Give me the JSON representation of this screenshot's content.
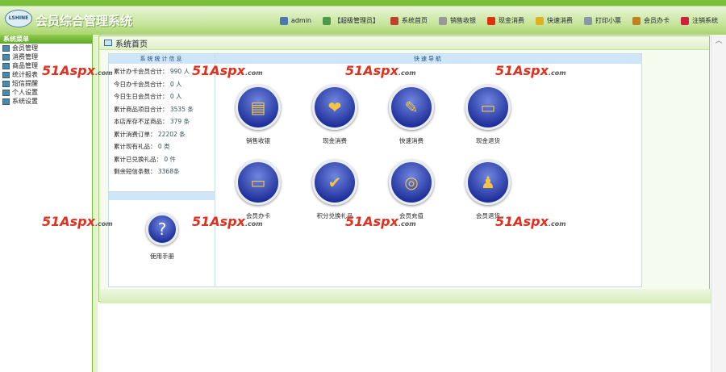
{
  "header": {
    "logo_text": "LSHINE",
    "title": "会员综合管理系统",
    "nav": [
      {
        "label": "admin",
        "icon": "user-icon",
        "color": "#4a7ab0"
      },
      {
        "label": "【超级管理员】",
        "icon": "users-icon",
        "color": "#4a9a4a"
      },
      {
        "label": "系统首页",
        "icon": "home-icon",
        "color": "#c04030"
      },
      {
        "label": "销售收银",
        "icon": "cashier-icon",
        "color": "#999999"
      },
      {
        "label": "现金消费",
        "icon": "cash-icon",
        "color": "#e03010"
      },
      {
        "label": "快速消费",
        "icon": "fast-pay-icon",
        "color": "#e0b020"
      },
      {
        "label": "打印小票",
        "icon": "print-icon",
        "color": "#8899aa"
      },
      {
        "label": "会员办卡",
        "icon": "card-icon",
        "color": "#c08020"
      },
      {
        "label": "注销系统",
        "icon": "logout-icon",
        "color": "#d02040"
      }
    ]
  },
  "sidebar": {
    "title": "系统菜单",
    "items": [
      "会员管理",
      "消费管理",
      "商品管理",
      "统计报表",
      "短信提醒",
      "个人设置",
      "系统设置"
    ]
  },
  "main": {
    "title": "系统首页",
    "stats": {
      "title": "系统统计信息",
      "rows": [
        {
          "label": "累计办卡会员合计：",
          "value": "990 人"
        },
        {
          "label": "今日办卡会员合计：",
          "value": "0 人"
        },
        {
          "label": "今日生日会员合计：",
          "value": "0 人"
        },
        {
          "label": "累计商品项目合计：",
          "value": "3535 条"
        },
        {
          "label": "本店库存不足商品：",
          "value": "379 条"
        },
        {
          "label": "累计消费订单：",
          "value": "22202 条"
        },
        {
          "label": "累计现有礼品：",
          "value": "0 类"
        },
        {
          "label": "累计已兑换礼品：",
          "value": "0 件"
        },
        {
          "label": "剩余短信条数：",
          "value": "3368条"
        }
      ]
    },
    "help_label": "使用手册",
    "quick": {
      "title": "快速导航",
      "items": [
        {
          "label": "销售收银",
          "icon": "cash-register-icon"
        },
        {
          "label": "现金消费",
          "icon": "gift-coins-icon"
        },
        {
          "label": "快速消费",
          "icon": "mouse-book-icon"
        },
        {
          "label": "现金退货",
          "icon": "card-return-icon"
        },
        {
          "label": "会员办卡",
          "icon": "member-card-icon"
        },
        {
          "label": "积分兑换礼品",
          "icon": "points-exchange-icon"
        },
        {
          "label": "会员充值",
          "icon": "recharge-icon"
        },
        {
          "label": "会员退货",
          "icon": "member-return-icon"
        }
      ]
    }
  },
  "watermark": "51Aspx.com"
}
